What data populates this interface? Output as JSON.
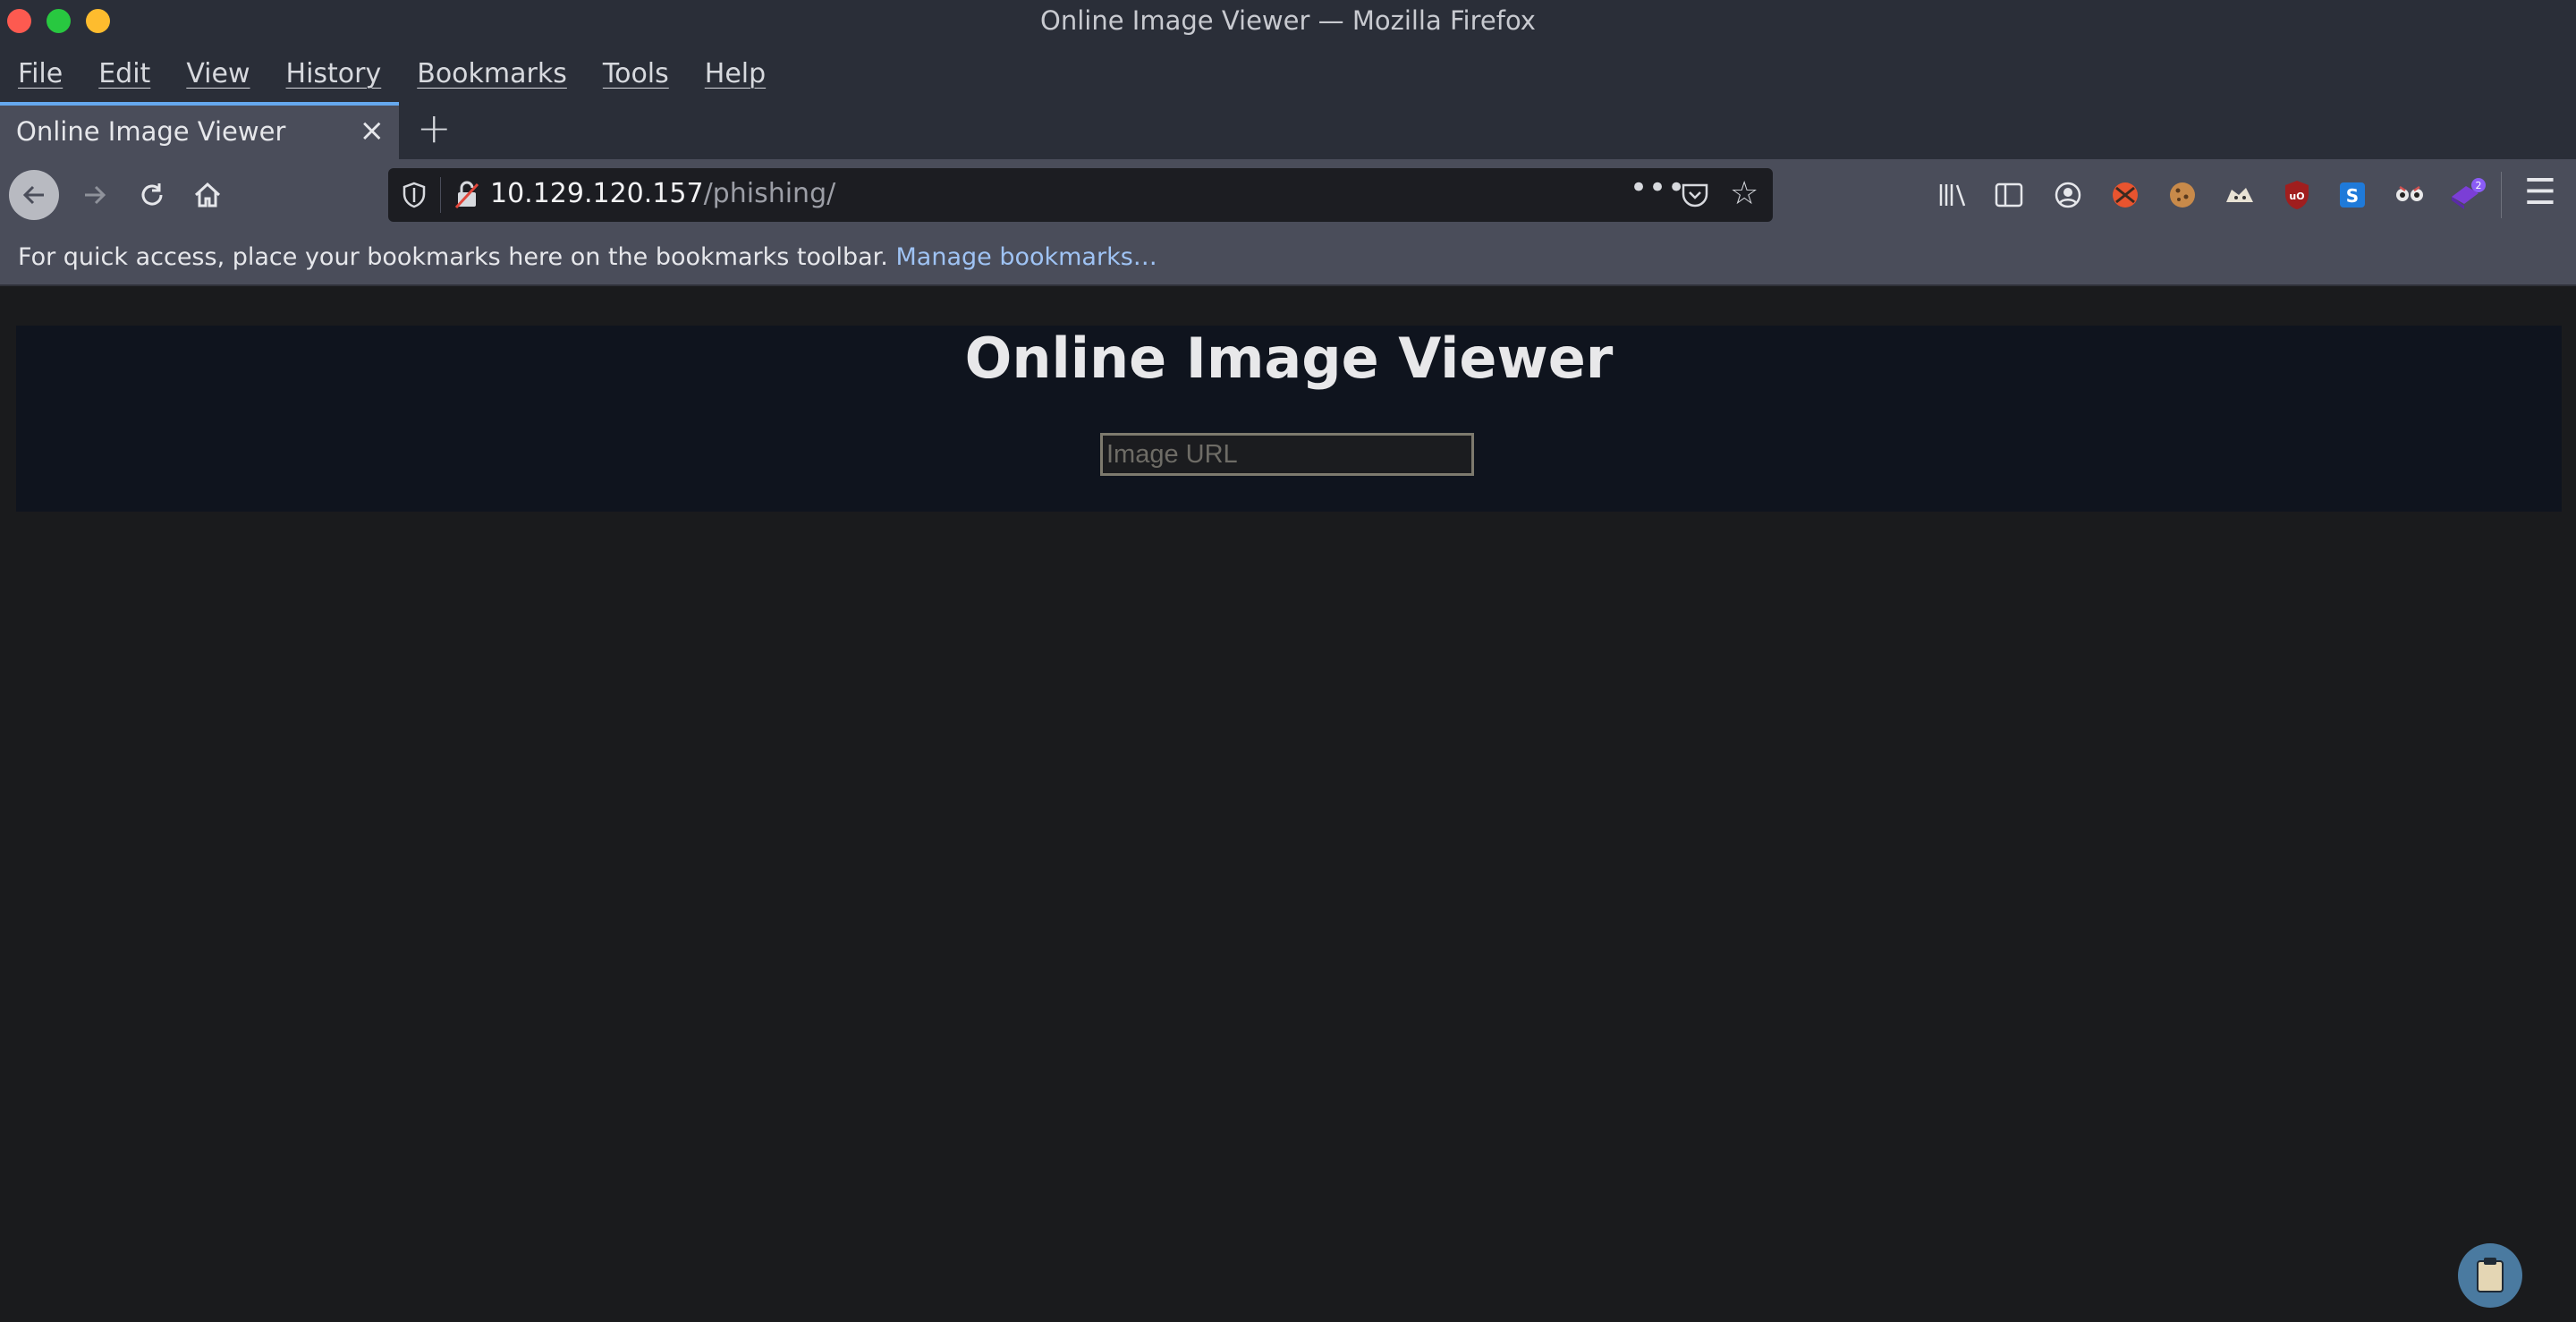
{
  "window": {
    "title": "Online Image Viewer — Mozilla Firefox"
  },
  "menu": [
    "File",
    "Edit",
    "View",
    "History",
    "Bookmarks",
    "Tools",
    "Help"
  ],
  "tab": {
    "title": "Online Image Viewer",
    "close": "×",
    "new_tab": "+"
  },
  "urlbar": {
    "host": "10.129.120.157",
    "path": "/phishing/",
    "more": "•••"
  },
  "toolbar_icons": [
    "library-icon",
    "sidebar-icon",
    "account-icon",
    "ext-red-icon",
    "cookie-icon",
    "ext-cat-icon",
    "ublock-icon",
    "ext-s-icon",
    "ext-glasses-icon",
    "ext-purple-icon"
  ],
  "ext_badge": "2",
  "bookmarks": {
    "message": "For quick access, place your bookmarks here on the bookmarks toolbar.",
    "manage": "Manage bookmarks…"
  },
  "page": {
    "heading": "Online Image Viewer",
    "input_placeholder": "Image URL"
  },
  "colors": {
    "chrome": "#2a2e38",
    "toolbar": "#4a4d5a",
    "page_bg": "#1a1b1d",
    "header_bg": "#0f141e",
    "link": "#9fc3f4",
    "tab_accent": "#65a8ee"
  }
}
